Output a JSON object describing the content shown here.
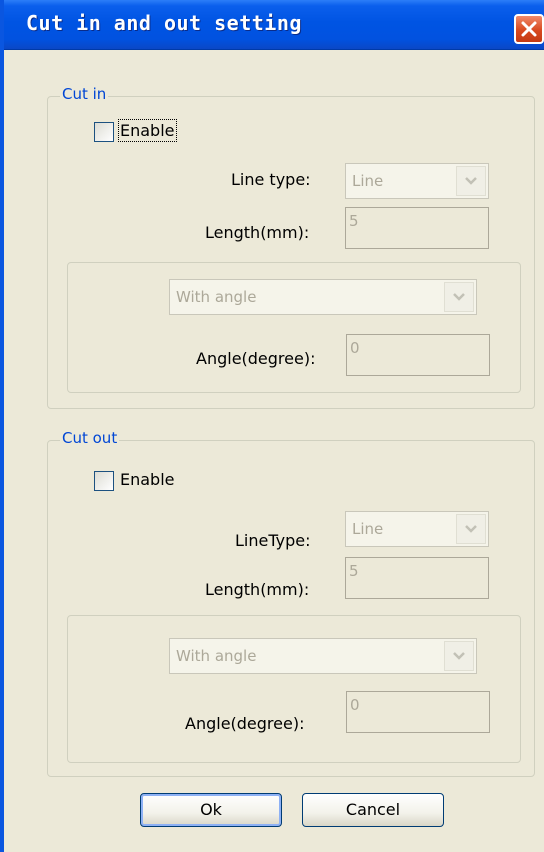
{
  "window": {
    "title": "Cut in and out setting"
  },
  "cut_in": {
    "group_label": "Cut in",
    "enable_label": "Enable",
    "enable_checked": false,
    "line_type_label": "Line type:",
    "line_type_value": "Line",
    "length_label": "Length(mm):",
    "length_value": "5",
    "angle_mode_value": "With angle",
    "angle_label": "Angle(degree):",
    "angle_value": "0"
  },
  "cut_out": {
    "group_label": "Cut out",
    "enable_label": "Enable",
    "enable_checked": false,
    "line_type_label": "LineType:",
    "line_type_value": "Line",
    "length_label": "Length(mm):",
    "length_value": "5",
    "angle_mode_value": "With angle",
    "angle_label": "Angle(degree):",
    "angle_value": "0"
  },
  "buttons": {
    "ok_label": "Ok",
    "cancel_label": "Cancel"
  },
  "icons": {
    "close": "close-icon",
    "dropdown": "chevron-down-icon"
  },
  "colors": {
    "titlebar": "#0054e3",
    "dialog_bg": "#ece9d8",
    "group_label": "#0046d5",
    "disabled_text": "#aca899",
    "close_button": "#d8491f"
  }
}
